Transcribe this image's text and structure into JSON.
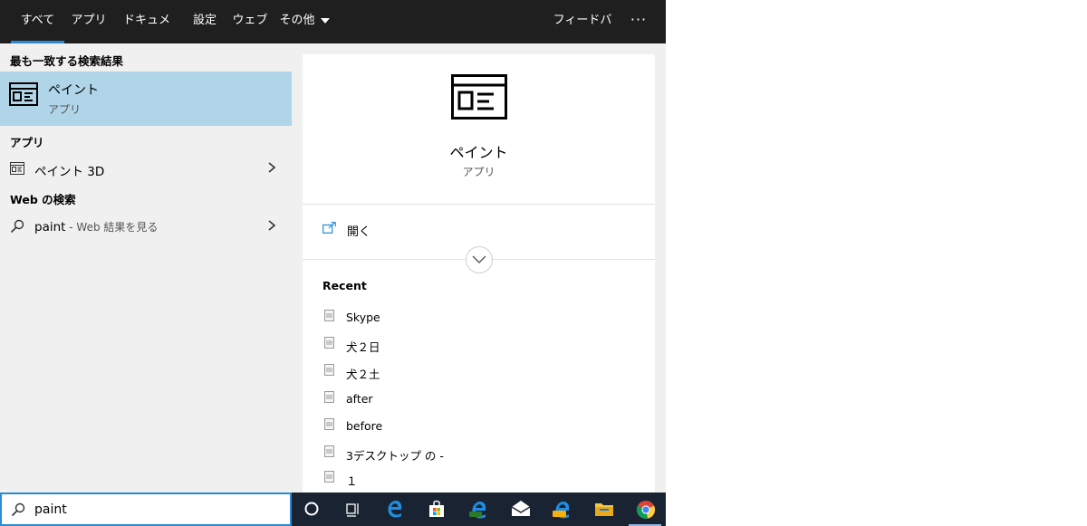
{
  "nav": {
    "tabs": [
      {
        "label": "すべて",
        "active": true
      },
      {
        "label": "アプリ"
      },
      {
        "label": "ドキュメント"
      },
      {
        "label": "設定"
      },
      {
        "label": "ウェブ"
      },
      {
        "label": "その他"
      }
    ],
    "feedback": "フィードバック",
    "more": "···"
  },
  "left": {
    "best_match_heading": "最も一致する検索結果",
    "best_match": {
      "title": "ペイント",
      "subtitle": "アプリ",
      "icon": "paint-app-icon"
    },
    "apps_heading": "アプリ",
    "apps": [
      {
        "label": "ペイント 3D",
        "icon": "paint3d-icon"
      }
    ],
    "web_heading": "Web の検索",
    "web": {
      "query": "paint",
      "suffix": " - Web 結果を見る",
      "icon": "search-icon"
    }
  },
  "right": {
    "title": "ペイント",
    "subtitle": "アプリ",
    "open_label": "開く",
    "recent_heading": "Recent",
    "recent": [
      "Skype",
      "犬２日",
      "犬２土",
      "after",
      "before",
      "3デスクトップ の -",
      "１"
    ]
  },
  "search": {
    "value": "paint"
  },
  "taskbar": {
    "items": [
      "cortana-icon",
      "task-view-icon",
      "edge-icon",
      "store-icon",
      "edge-dev-icon",
      "mail-icon",
      "edge-canary-icon",
      "file-explorer-icon",
      "chrome-icon"
    ]
  },
  "colors": {
    "accent": "#2a8ad4",
    "nav_bg": "#1f1f1f",
    "selected": "#b0d4e8",
    "taskbar": "#1a2332"
  }
}
